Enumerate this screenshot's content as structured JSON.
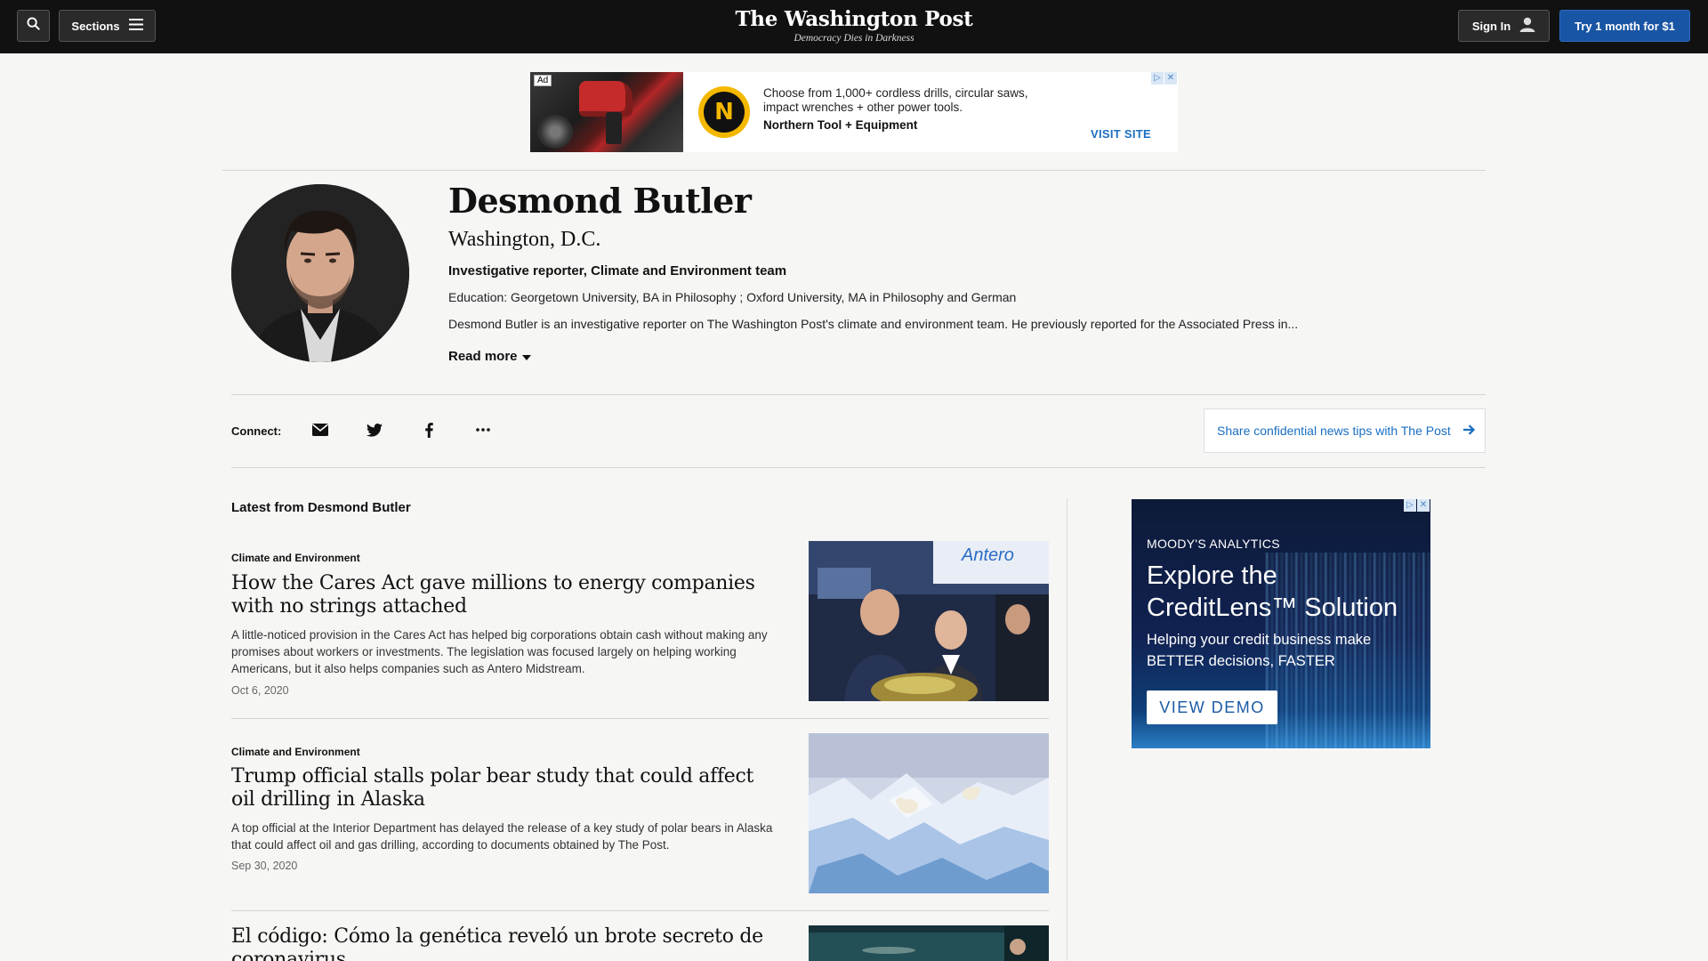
{
  "nav": {
    "sections_label": "Sections",
    "masthead_title": "The Washington Post",
    "masthead_tagline": "Democracy Dies in Darkness",
    "signin_label": "Sign In",
    "subscribe_label": "Try 1 month for $1"
  },
  "top_ad": {
    "ad_label": "Ad",
    "logo_letter": "N",
    "text": "Choose from 1,000+ cordless drills, circular saws, impact wrenches + other power tools.",
    "advertiser": "Northern Tool + Equipment",
    "cta": "VISIT SITE"
  },
  "author": {
    "name": "Desmond Butler",
    "location": "Washington, D.C.",
    "title": "Investigative reporter, Climate and Environment team",
    "education": "Education: Georgetown University, BA in Philosophy ; Oxford University, MA in Philosophy and German",
    "bio": "Desmond Butler is an investigative reporter on The Washington Post's climate and environment team. He previously reported for the Associated Press in...",
    "read_more": "Read more"
  },
  "connect": {
    "label": "Connect:",
    "icons": [
      "email-icon",
      "twitter-icon",
      "facebook-icon",
      "more-icon"
    ],
    "tips_label": "Share confidential news tips with The Post"
  },
  "latest": {
    "heading": "Latest from Desmond Butler",
    "articles": [
      {
        "kicker": "Climate and Environment",
        "headline": "How the Cares Act gave millions to energy companies with no strings attached",
        "blurb": "A little-noticed provision in the Cares Act has helped big corporations obtain cash without making any promises about workers or investments. The legislation was focused largely on helping working Americans, but it also helps companies such as Antero Midstream.",
        "date": "Oct 6, 2020",
        "image_text": "Antero"
      },
      {
        "kicker": "Climate and Environment",
        "headline": "Trump official stalls polar bear study that could affect oil drilling in Alaska",
        "blurb": "A top official at the Interior Department has delayed the release of a key study of polar bears in Alaska that could affect oil and gas drilling, according to documents obtained by The Post.",
        "date": "Sep 30, 2020"
      },
      {
        "kicker": "",
        "headline": "El código: Cómo la genética reveló un brote secreto de coronavirus",
        "blurb": "",
        "date": ""
      }
    ]
  },
  "right_ad": {
    "brand": "MOODY'S ANALYTICS",
    "headline": "Explore the CreditLens™ Solution",
    "subhead": "Helping your credit business make BETTER decisions, FASTER",
    "cta": "VIEW DEMO"
  },
  "colors": {
    "accent_blue": "#1955a5",
    "link_blue": "#1a6ec1",
    "nav_bg": "#111111",
    "page_bg": "#f6f6f5"
  }
}
